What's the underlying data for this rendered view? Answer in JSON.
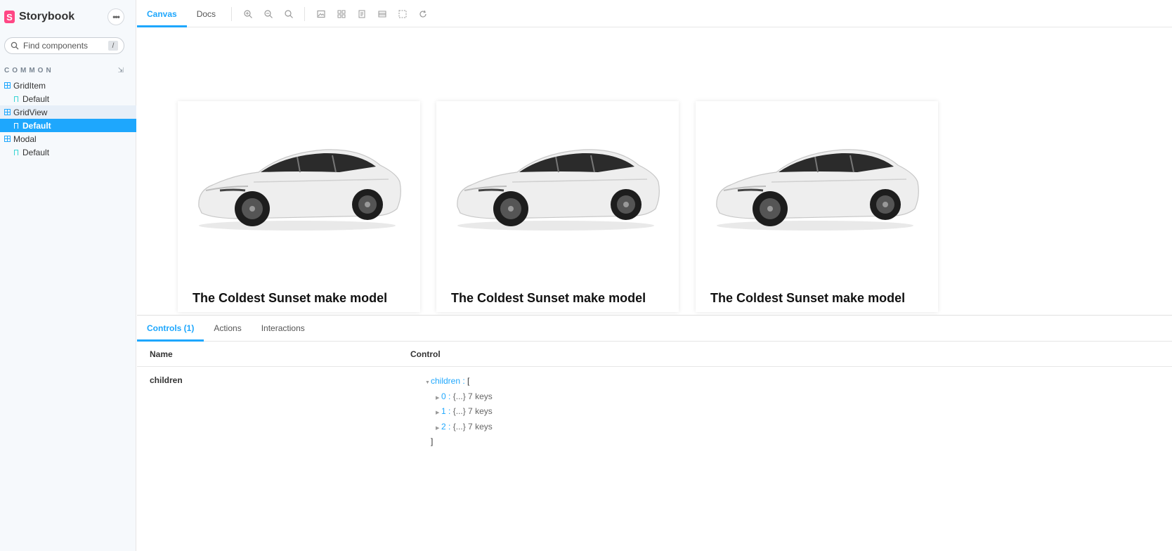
{
  "sidebar": {
    "brand": {
      "logo_letter": "S",
      "name": "Storybook"
    },
    "menu_icon": "ellipsis-icon",
    "search": {
      "placeholder": "Find components",
      "shortcut": "/"
    },
    "section": {
      "title": "COMMON"
    },
    "items": [
      {
        "type": "component",
        "label": "GridItem"
      },
      {
        "type": "story",
        "label": "Default"
      },
      {
        "type": "component",
        "label": "GridView"
      },
      {
        "type": "story",
        "label": "Default"
      },
      {
        "type": "component",
        "label": "Modal"
      },
      {
        "type": "story",
        "label": "Default"
      }
    ]
  },
  "toolbar": {
    "tabs": [
      {
        "label": "Canvas"
      },
      {
        "label": "Docs"
      }
    ],
    "tools": [
      "zoom-in-icon",
      "zoom-out-icon",
      "reset-zoom-icon",
      "background-icon",
      "grid-icon",
      "outline-icon",
      "viewport-icon",
      "measure-icon",
      "remount-icon"
    ]
  },
  "canvas": {
    "cards": [
      {
        "title_pre": "The Coldest Sunset ",
        "title_bold": "make",
        "title_post": " model"
      },
      {
        "title_pre": "The Coldest Sunset ",
        "title_bold": "make",
        "title_post": " model"
      },
      {
        "title_pre": "The Coldest Sunset ",
        "title_bold": "make",
        "title_post": " model"
      }
    ]
  },
  "addons": {
    "tabs": [
      {
        "label": "Controls (1)"
      },
      {
        "label": "Actions"
      },
      {
        "label": "Interactions"
      }
    ],
    "table": {
      "header_name": "Name",
      "header_control": "Control",
      "row_name": "children",
      "json": {
        "root_key": "children",
        "root_sep": " : ",
        "root_open": "[",
        "root_close": "]",
        "entries": [
          {
            "key": "0",
            "sep": " : ",
            "value": "{...} 7 keys"
          },
          {
            "key": "1",
            "sep": " : ",
            "value": "{...} 7 keys"
          },
          {
            "key": "2",
            "sep": " : ",
            "value": "{...} 7 keys"
          }
        ]
      }
    }
  },
  "colors": {
    "accent": "#1ea7fd",
    "brand": "#ff4785",
    "sidebar_bg": "#f6f9fc"
  }
}
